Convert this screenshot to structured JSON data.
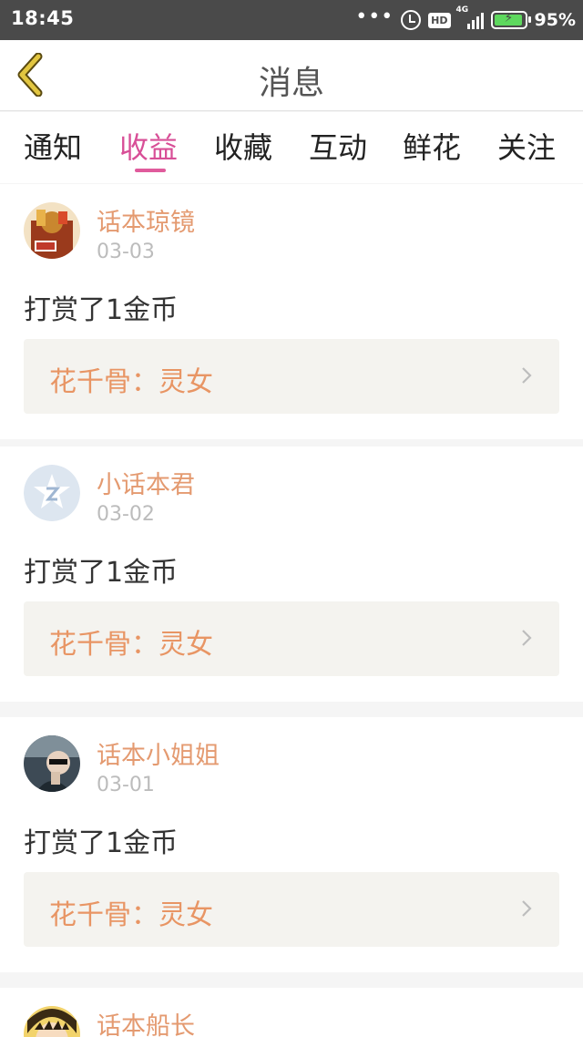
{
  "statusbar": {
    "time": "18:45",
    "dots": "•••",
    "hd": "HD",
    "network": "4G",
    "battery": "95%"
  },
  "header": {
    "title": "消息"
  },
  "tabs": [
    {
      "label": "通知"
    },
    {
      "label": "收益"
    },
    {
      "label": "收藏"
    },
    {
      "label": "互动"
    },
    {
      "label": "鲜花"
    },
    {
      "label": "关注"
    }
  ],
  "active_tab": "收益",
  "messages": [
    {
      "username": "话本琼镜",
      "date": "03-03",
      "text": "打赏了1金币",
      "link": "花千骨：灵女"
    },
    {
      "username": "小话本君",
      "date": "03-02",
      "text": "打赏了1金币",
      "link": "花千骨：灵女"
    },
    {
      "username": "话本小姐姐",
      "date": "03-01",
      "text": "打赏了1金币",
      "link": "花千骨：灵女"
    },
    {
      "username": "话本船长"
    }
  ],
  "colors": {
    "accent": "#d84f97",
    "username": "#e49a70",
    "link": "#e89564",
    "back": "#c9a227"
  }
}
